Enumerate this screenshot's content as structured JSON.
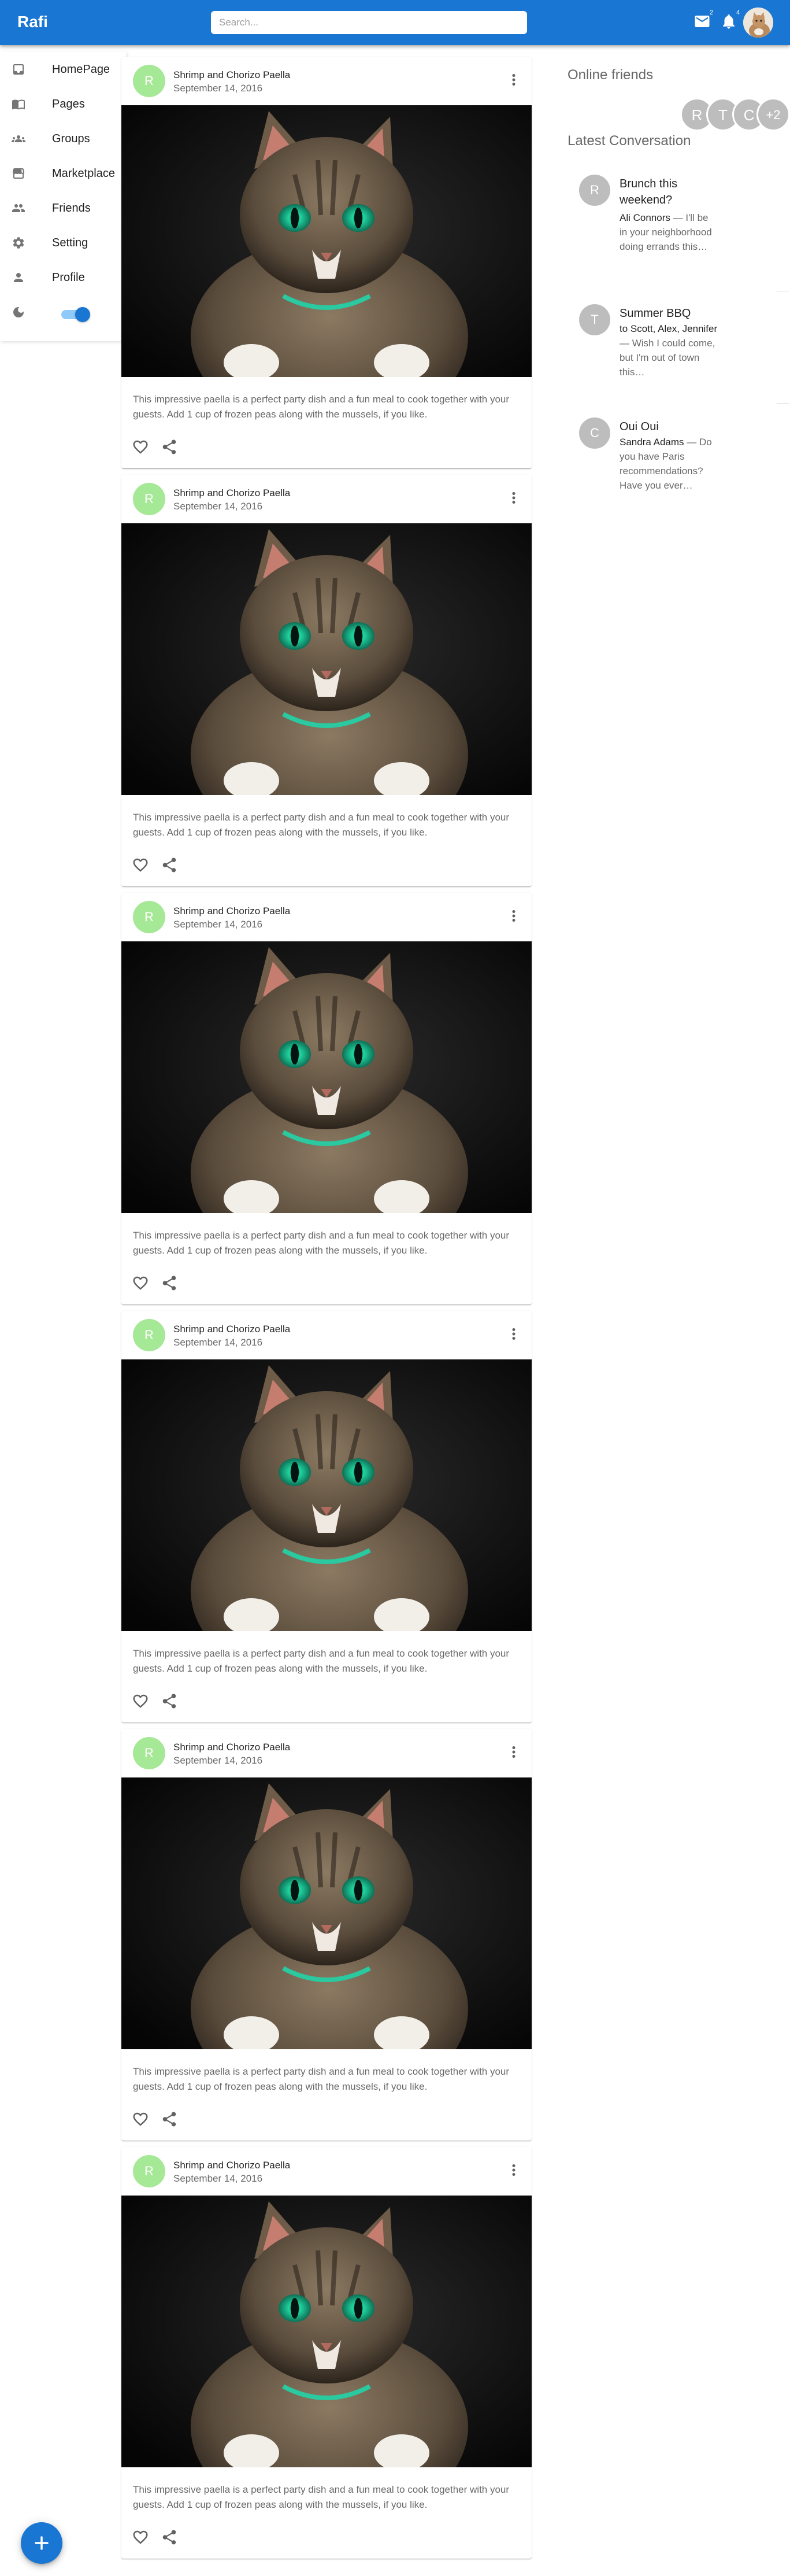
{
  "app": {
    "brand": "Rafi",
    "search_placeholder": "Search...",
    "mail_badge": "2",
    "notifications_badge": "4",
    "colors": {
      "primary": "#1976d2",
      "avatar_green": "#a5e896",
      "avatar_grey": "#bdbdbd"
    }
  },
  "sidebar": {
    "items": [
      {
        "label": "HomePage",
        "icon": "inbox-icon"
      },
      {
        "label": "Pages",
        "icon": "pages-icon"
      },
      {
        "label": "Groups",
        "icon": "groups-icon"
      },
      {
        "label": "Marketplace",
        "icon": "storefront-icon"
      },
      {
        "label": "Friends",
        "icon": "friends-icon"
      },
      {
        "label": "Setting",
        "icon": "gear-icon"
      },
      {
        "label": "Profile",
        "icon": "person-icon"
      }
    ],
    "dark_mode_icon": "moon-icon",
    "dark_mode_on": true
  },
  "posts": [
    {
      "avatar": "R",
      "title": "Shrimp and Chorizo Paella",
      "date": "September 14, 2016",
      "text": "This impressive paella is a perfect party dish and a fun meal to cook together with your guests. Add 1 cup of frozen peas along with the mussels, if you like."
    },
    {
      "avatar": "R",
      "title": "Shrimp and Chorizo Paella",
      "date": "September 14, 2016",
      "text": "This impressive paella is a perfect party dish and a fun meal to cook together with your guests. Add 1 cup of frozen peas along with the mussels, if you like."
    },
    {
      "avatar": "R",
      "title": "Shrimp and Chorizo Paella",
      "date": "September 14, 2016",
      "text": "This impressive paella is a perfect party dish and a fun meal to cook together with your guests. Add 1 cup of frozen peas along with the mussels, if you like."
    },
    {
      "avatar": "R",
      "title": "Shrimp and Chorizo Paella",
      "date": "September 14, 2016",
      "text": "This impressive paella is a perfect party dish and a fun meal to cook together with your guests. Add 1 cup of frozen peas along with the mussels, if you like."
    },
    {
      "avatar": "R",
      "title": "Shrimp and Chorizo Paella",
      "date": "September 14, 2016",
      "text": "This impressive paella is a perfect party dish and a fun meal to cook together with your guests. Add 1 cup of frozen peas along with the mussels, if you like."
    },
    {
      "avatar": "R",
      "title": "Shrimp and Chorizo Paella",
      "date": "September 14, 2016",
      "text": "This impressive paella is a perfect party dish and a fun meal to cook together with your guests. Add 1 cup of frozen peas along with the mussels, if you like."
    }
  ],
  "right_panel": {
    "online_heading": "Online friends",
    "online_friends": [
      "R",
      "T",
      "C",
      "+2"
    ],
    "conversation_heading": "Latest Conversation",
    "conversations": [
      {
        "avatar": "R",
        "title": "Brunch this weekend?",
        "who": "Ali Connors",
        "snippet": " — I'll be in your neighborhood doing errands this…"
      },
      {
        "avatar": "T",
        "title": "Summer BBQ",
        "who": "to Scott, Alex, Jennifer",
        "snippet": " — Wish I could come, but I'm out of town this…"
      },
      {
        "avatar": "C",
        "title": "Oui Oui",
        "who": "Sandra Adams",
        "snippet": " — Do you have Paris recommendations? Have you ever…"
      }
    ]
  },
  "fab": {
    "icon": "add-icon"
  }
}
